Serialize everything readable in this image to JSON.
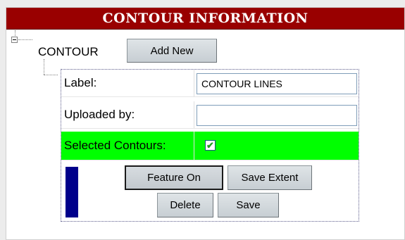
{
  "header": {
    "title": "CONTOUR INFORMATION"
  },
  "tree": {
    "node_label": "CONTOUR",
    "add_new_label": "Add New"
  },
  "form": {
    "label_field": {
      "label": "Label:",
      "value": "CONTOUR LINES"
    },
    "uploaded_field": {
      "label": "Uploaded by:",
      "value": ""
    },
    "selected_field": {
      "label": "Selected Contours:",
      "checked": true,
      "check_glyph": "✔"
    }
  },
  "actions": {
    "feature_on": "Feature On",
    "save_extent": "Save Extent",
    "delete": "Delete",
    "save": "Save"
  },
  "colors": {
    "header_bg": "#990000",
    "selected_row_bg": "#00ff00",
    "swatch": "#00008b"
  }
}
